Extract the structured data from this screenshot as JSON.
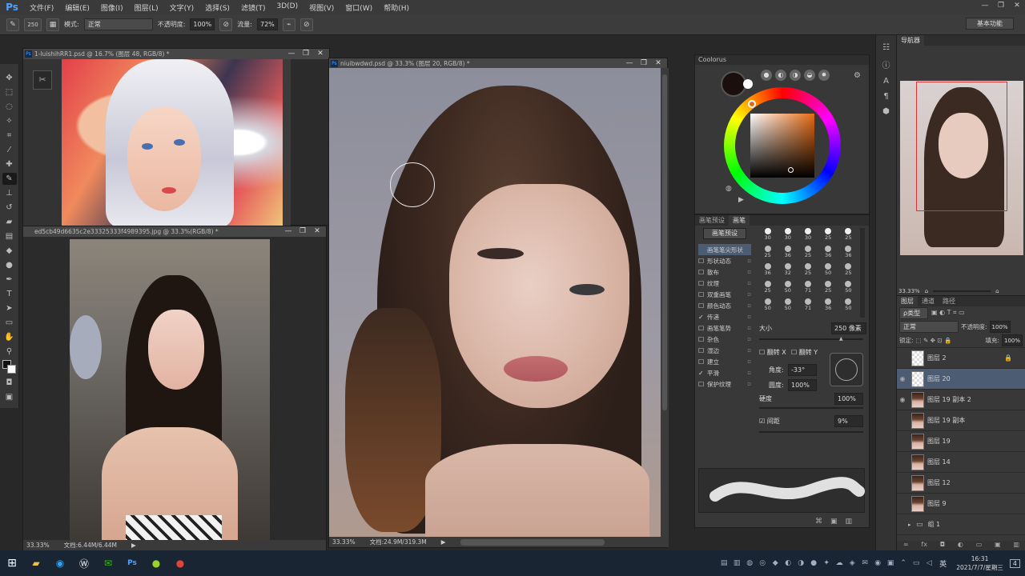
{
  "app": {
    "logo": "Ps"
  },
  "menubar": {
    "items": [
      "文件(F)",
      "编辑(E)",
      "图像(I)",
      "图层(L)",
      "文字(Y)",
      "选择(S)",
      "滤镜(T)",
      "3D(D)",
      "视图(V)",
      "窗口(W)",
      "帮助(H)"
    ],
    "window_controls": [
      "—",
      "❐",
      "✕"
    ]
  },
  "options": {
    "brush_size": "250",
    "mode_label": "模式:",
    "mode_value": "正常",
    "opacity_label": "不透明度:",
    "opacity_value": "100%",
    "flow_label": "流量:",
    "flow_value": "72%",
    "workspace": "基本功能"
  },
  "doc1": {
    "title": "1-luishihRR1.psd @ 16.7% (图层 48, RGB/8) *"
  },
  "doc2": {
    "title": "ed5cb49d6635c2e33325333f4989395.jpg @ 33.3%(RGB/8) *",
    "zoom": "33.33%",
    "doc_info": "文档:6.44M/6.44M"
  },
  "doc3": {
    "title": "niuibwdwd.psd @ 33.3% (图层 20, RGB/8) *",
    "zoom": "33.33%",
    "doc_info": "文档:24.9M/319.3M"
  },
  "coolorus": {
    "title": "Coolorus",
    "foreground_color": "#1a0f0c"
  },
  "brush_panel": {
    "tabs": [
      "画笔预设",
      "画笔"
    ],
    "preset_button": "画笔预设",
    "options": [
      {
        "label": "画笔笔尖形状",
        "checked": false,
        "active": true
      },
      {
        "label": "形状动态",
        "checked": false
      },
      {
        "label": "散布",
        "checked": false
      },
      {
        "label": "纹理",
        "checked": false
      },
      {
        "label": "双重画笔",
        "checked": false
      },
      {
        "label": "颜色动态",
        "checked": false
      },
      {
        "label": "传递",
        "checked": true
      },
      {
        "label": "画笔笔势",
        "checked": false
      },
      {
        "label": "杂色",
        "checked": false
      },
      {
        "label": "湿边",
        "checked": false
      },
      {
        "label": "建立",
        "checked": false
      },
      {
        "label": "平滑",
        "checked": true
      },
      {
        "label": "保护纹理",
        "checked": false
      }
    ],
    "tip_sizes": [
      "30",
      "30",
      "30",
      "25",
      "25",
      "25",
      "36",
      "25",
      "36",
      "36",
      "36",
      "32",
      "25",
      "50",
      "25",
      "25",
      "50",
      "71",
      "25",
      "50",
      "50",
      "50",
      "71",
      "36",
      "50"
    ],
    "size_label": "大小",
    "size_value": "250 像素",
    "flip_x": "翻转 X",
    "flip_y": "翻转 Y",
    "angle_label": "角度:",
    "angle_value": "-33°",
    "roundness_label": "圆度:",
    "roundness_value": "100%",
    "hardness_label": "硬度",
    "hardness_value": "100%",
    "spacing_label": "间距",
    "spacing_value": "9%"
  },
  "navigator": {
    "title": "导航器",
    "zoom": "33.33%"
  },
  "layers": {
    "tabs": [
      "图层",
      "通道",
      "路径"
    ],
    "filter_label": "ρ类型",
    "blend_mode": "正常",
    "opacity_label": "不透明度:",
    "opacity_value": "100%",
    "lock_label": "锁定:",
    "fill_label": "填充:",
    "fill_value": "100%",
    "items": [
      {
        "name": "图层 2",
        "visible": false,
        "thumb": "trans",
        "locked": true
      },
      {
        "name": "图层 20",
        "visible": true,
        "thumb": "trans",
        "selected": true
      },
      {
        "name": "图层 19 副本 2",
        "visible": true,
        "thumb": "face"
      },
      {
        "name": "图层 19 副本",
        "visible": false,
        "thumb": "face"
      },
      {
        "name": "图层 19",
        "visible": false,
        "thumb": "face"
      },
      {
        "name": "图层 14",
        "visible": false,
        "thumb": "face"
      },
      {
        "name": "图层 12",
        "visible": false,
        "thumb": "face"
      },
      {
        "name": "图层 9",
        "visible": false,
        "thumb": "face"
      },
      {
        "name": "组 1",
        "visible": false,
        "thumb": "folder"
      }
    ]
  },
  "taskbar": {
    "time": "16:31",
    "date": "2021/7/7/星期三",
    "ime": "英",
    "notification_count": "4"
  }
}
